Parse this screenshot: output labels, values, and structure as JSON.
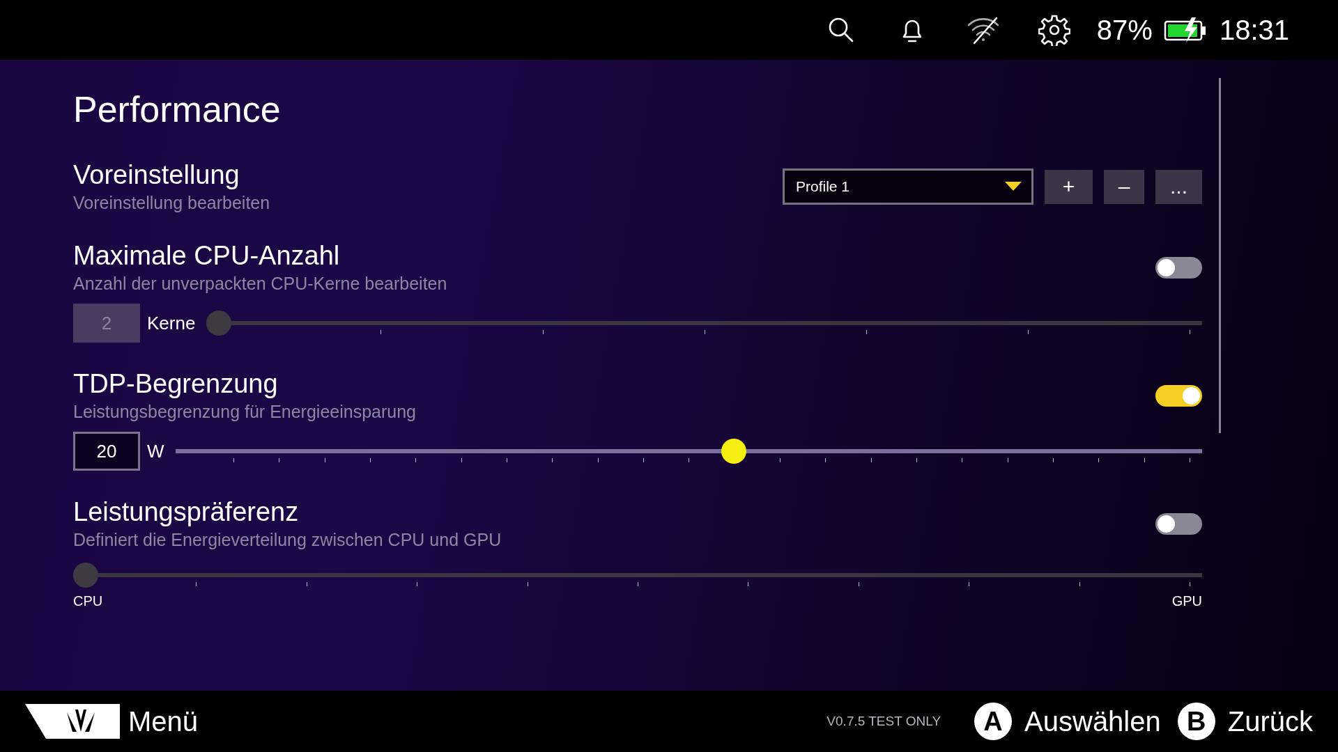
{
  "status_bar": {
    "battery_percent": "87%",
    "time": "18:31"
  },
  "title": "Performance",
  "preset": {
    "title": "Voreinstellung",
    "subtitle": "Voreinstellung bearbeiten",
    "dropdown": {
      "value": "Profile 1"
    },
    "buttons": [
      "+",
      "–",
      "..."
    ]
  },
  "settings": [
    {
      "kind": "value-slider",
      "title": "Maximale CPU-Anzahl",
      "subtitle": "Anzahl der unverpackten CPU-Kerne bearbeiten",
      "on": false,
      "value": "2",
      "unit": "Kerne",
      "slider": {
        "kind": "cores",
        "level": 0
      }
    },
    {
      "kind": "value-slider",
      "title": "TDP-Begrenzung",
      "subtitle": "Leistungsbegrenzung für Energieeinsparung",
      "on": true,
      "value": "20",
      "unit": "W",
      "slider": {
        "kind": "watts",
        "level": 0.545
      }
    },
    {
      "kind": "range-slider",
      "title": "Leistungspräferenz",
      "subtitle": "Definiert die Energieverteilung zwischen CPU und GPU",
      "on": false,
      "slider": {
        "kind": "balance",
        "level": 0
      },
      "start_label": "CPU",
      "end_label": "GPU"
    }
  ],
  "footer": {
    "menu": "Menü",
    "version": "V0.7.5 TEST ONLY",
    "actions": [
      {
        "key": "A",
        "label": "Auswählen"
      },
      {
        "key": "B",
        "label": "Zurück"
      }
    ]
  }
}
